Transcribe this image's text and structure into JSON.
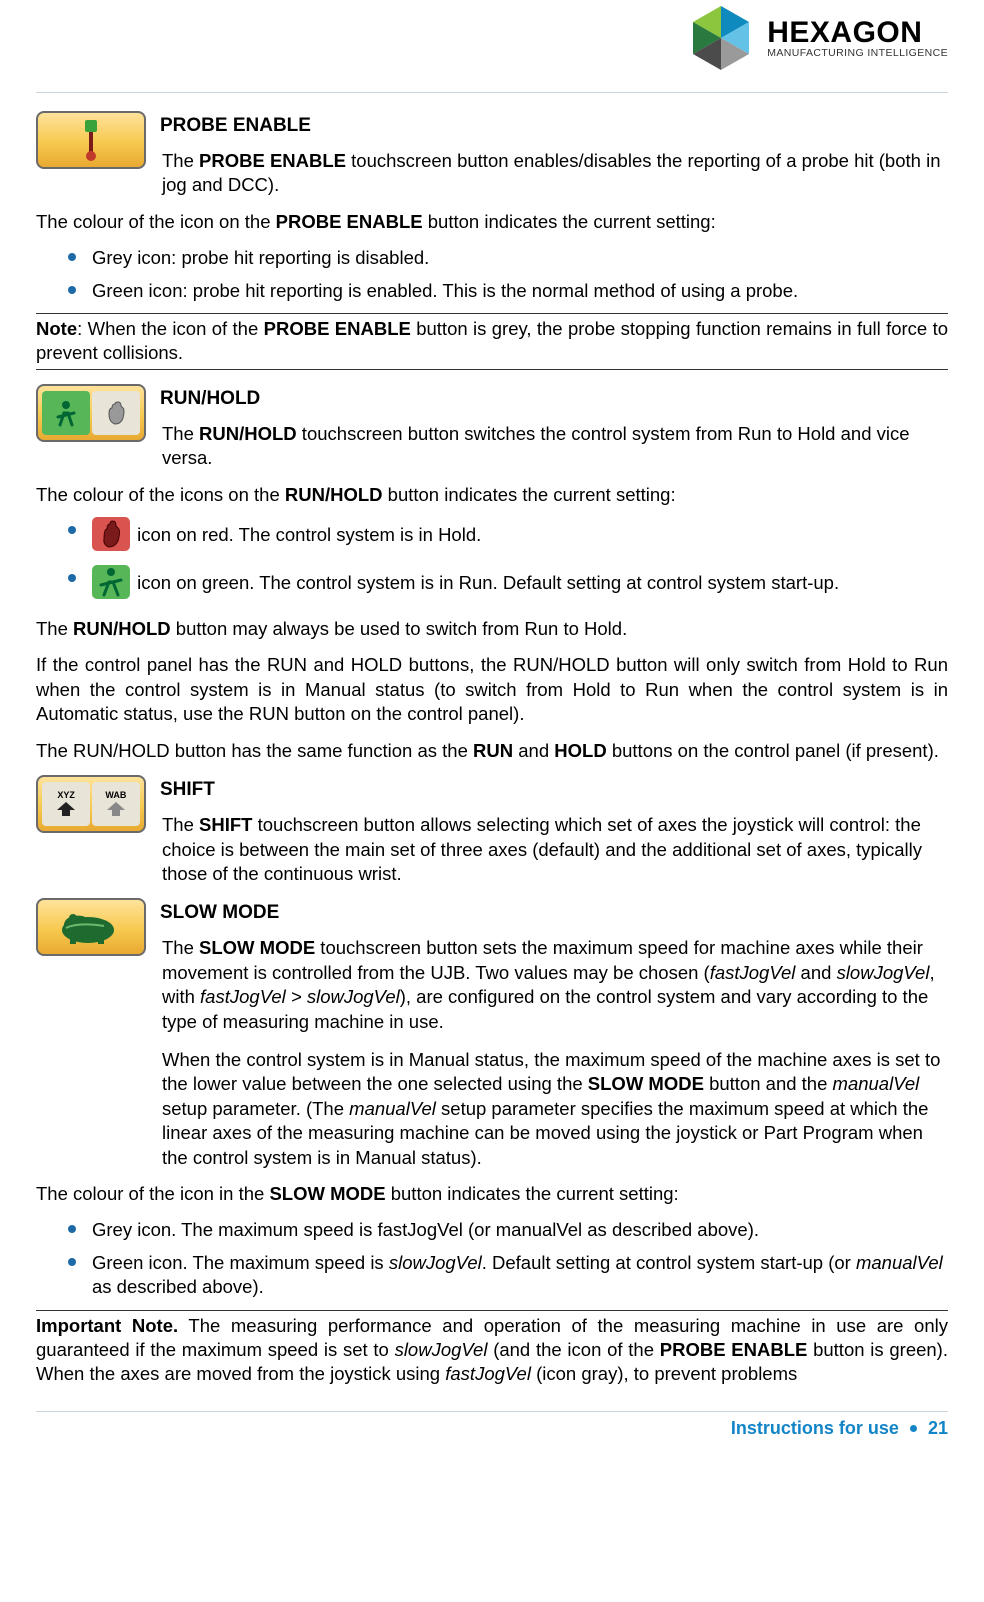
{
  "brand": {
    "name": "HEXAGON",
    "subtitle": "MANUFACTURING INTELLIGENCE"
  },
  "probe_enable": {
    "title": "PROBE ENABLE",
    "desc_pre": "The ",
    "desc_bold": "PROBE ENABLE",
    "desc_post": " touchscreen button enables/disables the reporting of a probe hit (both in jog and DCC).",
    "setting_pre": "The colour of the icon on the ",
    "setting_bold": "PROBE ENABLE",
    "setting_post": " button indicates the current setting:",
    "bullets": [
      "Grey icon: probe hit reporting is disabled.",
      "Green icon: probe hit reporting is enabled. This is the normal method of using a probe."
    ],
    "note_label": "Note",
    "note_pre": ": When the icon of the ",
    "note_bold": "PROBE ENABLE",
    "note_post": " button is grey, the probe stopping function remains in full force to prevent collisions."
  },
  "run_hold": {
    "title": "RUN/HOLD",
    "desc_pre": "The ",
    "desc_bold": "RUN/HOLD",
    "desc_post": " touchscreen button switches the control system from Run to Hold and vice versa.",
    "setting_pre": "The colour of the icons on the ",
    "setting_bold": "RUN/HOLD",
    "setting_post": " button indicates the current setting:",
    "bullet_hold": " icon on red. The control system is in Hold.",
    "bullet_run": " icon on green. The control system is in Run. Default setting at control system start-up.",
    "p_switch1_pre": "The ",
    "p_switch1_bold": "RUN/HOLD",
    "p_switch1_post": " button may always be used to switch from Run to Hold.",
    "p_switch2": "If the control panel has the RUN and HOLD buttons, the RUN/HOLD button will only switch from Hold to Run when the control system is in Manual status (to switch from Hold to Run when the control system is in Automatic status, use the RUN button on the control panel).",
    "p_same_pre": "The RUN/HOLD button has the same function as the ",
    "p_same_b1": "RUN",
    "p_same_mid": " and ",
    "p_same_b2": "HOLD",
    "p_same_post": " buttons on the control panel (if present)."
  },
  "shift": {
    "title": "SHIFT",
    "desc_pre": "The ",
    "desc_bold": "SHIFT",
    "desc_post": " touchscreen button allows selecting which set of axes the joystick will control: the choice is between the main set of three axes (default) and the additional set of axes, typically those of the continuous wrist."
  },
  "slow_mode": {
    "title": "SLOW MODE",
    "p1_pre": "The ",
    "p1_bold": "SLOW MODE",
    "p1_a": " touchscreen button sets the maximum speed for machine axes while their movement is controlled from the UJB. Two values may be chosen (",
    "p1_i1": "fastJogVel",
    "p1_b": " and ",
    "p1_i2": "slowJogVel",
    "p1_c": ", with ",
    "p1_i3": "fastJogVel > slowJogVel",
    "p1_d": "), are configured on the control system and vary according to the type of measuring machine in use.",
    "p2_a": "When the control system is in Manual status, the maximum speed of the machine axes is set to the lower value between the one selected using the ",
    "p2_b1": "SLOW MODE",
    "p2_b": " button and the ",
    "p2_i1": "manualVel",
    "p2_c": " setup parameter. (The ",
    "p2_i2": "manualVel",
    "p2_d": " setup parameter specifies the maximum speed at which the linear axes of the measuring machine can be moved using the joystick or Part Program when the control system is in Manual status).",
    "setting_pre": "The colour of the icon in the ",
    "setting_bold": "SLOW MODE",
    "setting_post": " button indicates the current setting:",
    "bullet1": "Grey icon. The maximum speed is fastJogVel (or manualVel as described above).",
    "bullet2_a": "Green icon. The maximum speed is ",
    "bullet2_i": "slowJogVel",
    "bullet2_b": ". Default setting at control system start-up (or ",
    "bullet2_i2": "manualVel",
    "bullet2_c": " as described above).",
    "important_label": "Important Note.",
    "important_a": " The measuring performance and operation of the measuring machine in use are only guaranteed if the maximum speed is set to ",
    "important_i1": "slowJogVel",
    "important_b": " (and the icon of the ",
    "important_bold": "PROBE ENABLE",
    "important_c": " button is green). When the axes are moved from the joystick using ",
    "important_i2": "fastJogVel",
    "important_d": " (icon gray), to prevent problems"
  },
  "footer": {
    "label": "Instructions for use",
    "page": "21"
  }
}
